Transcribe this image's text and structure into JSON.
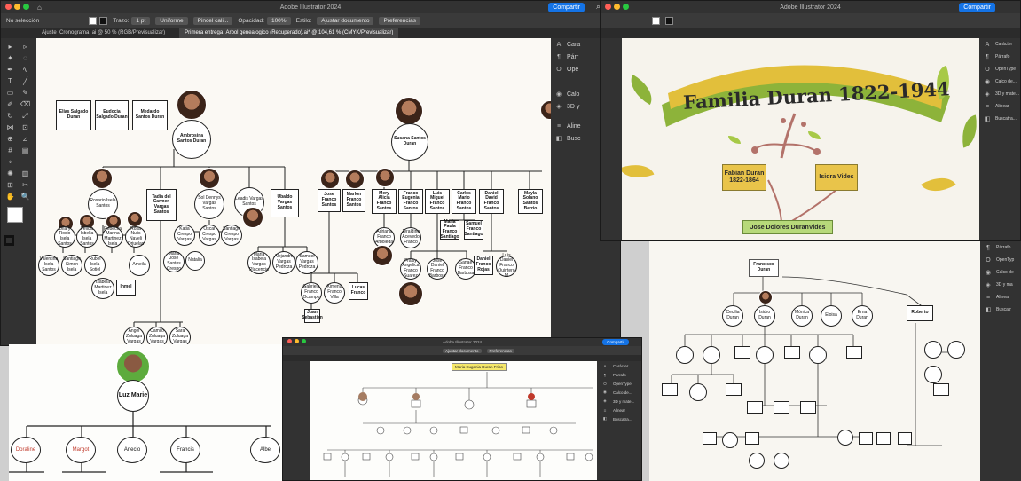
{
  "windows": {
    "main": {
      "title": "Adobe Illustrator 2024",
      "share": "Compartir",
      "selection": "No selección",
      "stroke_label": "Trazo:",
      "stroke_weight": "1 pt",
      "stroke_style": "Uniforme",
      "brush": "Pincel cali...",
      "opacity_label": "Opacidad:",
      "opacity_value": "100%",
      "style_label": "Estilo:",
      "adjust_doc": "Ajustar documento",
      "preferences": "Preferencias",
      "tabs": [
        "Ajuste_Cronograma_ai @ 50 % (RGB/Previsualizar)",
        "Primera entrega_Arbol genealogico (Recuperado).ai* @ 104,61 % (CMYK/Previsualizar)"
      ],
      "panels": [
        "Cara",
        "Párr",
        "Ope",
        "Calo",
        "3D y",
        "Aline",
        "Busc"
      ]
    },
    "right": {
      "title": "Adobe Illustrator 2024",
      "share": "Compartir",
      "panels": [
        "Carácter",
        "Párrafo",
        "OpenType",
        "Calco de...",
        "3D y mate...",
        "Alinear",
        "Buscatra..."
      ],
      "panels_lower": [
        "Párrafo",
        "OpenTyp",
        "Calco de",
        "3D y ma",
        "Alinear",
        "Buscatr"
      ]
    },
    "bottom": {
      "title": "Adobe Illustrator 2024",
      "share": "Compartir",
      "adjust_doc": "Ajustar documento",
      "preferences": "Preferencias",
      "popup": "Maria Eugenia Duran Frias",
      "panels": [
        "Carácter",
        "Párrafo",
        "OpenType",
        "Calco de...",
        "3D y mate...",
        "Alinear",
        "Buscatra..."
      ]
    }
  },
  "tree1": {
    "top_row": [
      "Elías Salgado Duran",
      "Eudocia Salgado Duran",
      "Medardo Santos Duran"
    ],
    "root": "Ambrosina Santos Duran",
    "children": [
      "Rosario Isela Santos",
      "Tadia del Carmen Vargas Santos",
      "Sol Dennys Vargas Santos",
      "Leadis Vargas Santos",
      "Ubaldo Vargas Santos"
    ],
    "grand_a": [
      "Dilary Rosio Isela Santos",
      "Felicia Isbelia Isela Santos",
      "Rebecca Marina Martinez Isela",
      "Rosa Nulis Nayeli Orjuelas"
    ],
    "grand_b": [
      "Valentina Isela Santos",
      "Santiago Simon Isela",
      "Rubel Isela Sotiel",
      "Ameila",
      "Isabela Martinez Isela",
      "Inmel"
    ],
    "grand_c": [
      "Katia Crespo Vargas",
      "Oscar Crespo Vargas",
      "Santiago Crespo Vargas",
      "Natalia",
      "Maria José Santos Crespo"
    ],
    "grand_d": [
      "Maria Isabela Vargas Placencia",
      "Alejandro Vargas Pedroza",
      "Samuel Vargas Pedroza"
    ],
    "grand_e": [
      "Angel Zuluaga Vargas",
      "Camilo Zuluaga Vargas",
      "Sara Zuluaga Vargas"
    ],
    "root2": "Susana Santos Duran",
    "children2": [
      "Jose Franco Santos",
      "Marlon Franco Santos",
      "Mery Alicia Franco Santos",
      "Franco Eugenia Franco Santos",
      "Luis Miguel Franco Santos",
      "Carlos Mario Franco Santos",
      "Daniel David Franco Santos",
      "Mayla Solano Santos Berrio"
    ],
    "grand2": [
      "Gabriela Franco Ocampo",
      "Ximena Franco Villa",
      "Lucas Franco",
      "Juan Sebastian",
      "Adriana Franco Arboleda",
      "Jeraldine Acevedo Franco",
      "Fraisy Angelica Franco Suarez",
      "Jose Daniel Franco Barbosa",
      "Sanae Franco Barbosa",
      "Maria Paula Franco Santiago",
      "Samuel Franco Santiago",
      "Daniel Franco Rojas",
      "Luis Daniel Franco Quintero M"
    ]
  },
  "tree2": {
    "banner": "Familia Duran 1822-1944",
    "left_parent": "Fabian Duran 1822-1864",
    "right_parent": "Isidra Vides",
    "child": "Jose Dolores DuranVides",
    "top": "Francisco Duran",
    "kids": [
      "Cecilia Duran",
      "Isidro Duran",
      "Mónica Duran",
      "Eloisa",
      "Erna Duran",
      "Roberto"
    ]
  },
  "tree3": {
    "root": "Luz Marie",
    "kids": [
      "Doraline",
      "Margot",
      "Arlecio",
      "Francis",
      "Albe"
    ]
  }
}
